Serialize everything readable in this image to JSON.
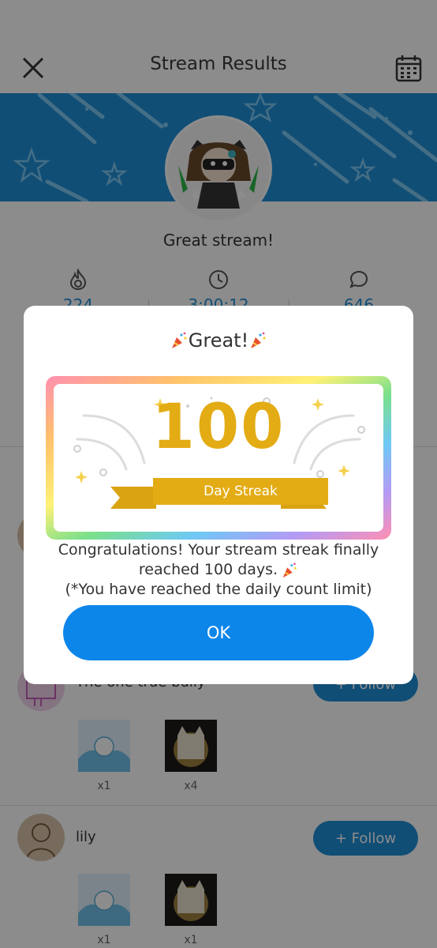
{
  "header": {
    "title": "Stream Results"
  },
  "summary": {
    "message": "Great stream!",
    "stats": [
      {
        "icon": "flame-icon",
        "value": "224"
      },
      {
        "icon": "clock-icon",
        "value": "3:00:12"
      },
      {
        "icon": "chat-icon",
        "value": "646"
      }
    ]
  },
  "supporters": [
    {
      "name": "The one true bully",
      "follow_label": "+ Follow",
      "gifts": [
        {
          "icon": "splash-cat-gift-icon",
          "count": "x1"
        },
        {
          "icon": "glowing-cat-gift-icon",
          "count": "x4"
        }
      ]
    },
    {
      "name": "lily",
      "follow_label": "+ Follow",
      "gifts": [
        {
          "icon": "splash-cat-gift-icon",
          "count": "x1"
        },
        {
          "icon": "glowing-cat-gift-icon",
          "count": "x1"
        }
      ]
    }
  ],
  "modal": {
    "heading": "Great!",
    "badge_number": "100",
    "badge_label": "Day Streak",
    "message_line1": "Congratulations! Your stream streak finally",
    "message_line2": "reached 100 days.",
    "message_line3": "(*You have reached the daily count limit)",
    "ok_label": "OK"
  },
  "colors": {
    "accent": "#1f8fd8",
    "ok_button": "#0d86ea",
    "badge_gold": "#e3ac15"
  }
}
